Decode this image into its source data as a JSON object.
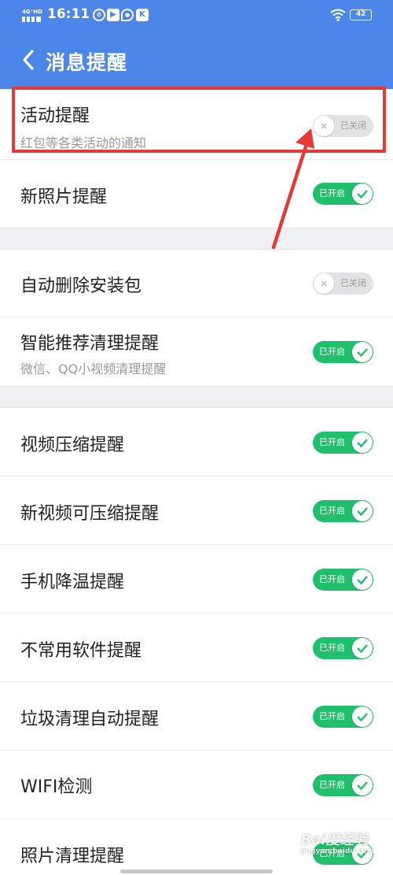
{
  "status_bar": {
    "network": "4G⁺HD",
    "time": "16:11",
    "app_icons": [
      "stopwatch-icon",
      "play-icon",
      "location-icon",
      "kuaishou-icon"
    ],
    "battery": "42"
  },
  "header": {
    "back_icon": "chevron-left-icon",
    "title": "消息提醒"
  },
  "toggle_text": {
    "on": "已开启",
    "off": "已关闭"
  },
  "groups": [
    {
      "rows": [
        {
          "label": "活动提醒",
          "sublabel": "红包等各类活动的通知",
          "enabled": false,
          "highlighted": true
        },
        {
          "label": "新照片提醒",
          "enabled": true
        }
      ]
    },
    {
      "rows": [
        {
          "label": "自动删除安装包",
          "enabled": false
        },
        {
          "label": "智能推荐清理提醒",
          "sublabel": "微信、QQ小视频清理提醒",
          "enabled": true
        }
      ]
    },
    {
      "rows": [
        {
          "label": "视频压缩提醒",
          "enabled": true
        },
        {
          "label": "新视频可压缩提醒",
          "enabled": true
        },
        {
          "label": "手机降温提醒",
          "enabled": true
        },
        {
          "label": "不常用软件提醒",
          "enabled": true
        },
        {
          "label": "垃圾清理自动提醒",
          "enabled": true
        },
        {
          "label": "WIFI检测",
          "enabled": true
        },
        {
          "label": "照片清理提醒",
          "enabled": true
        }
      ]
    }
  ],
  "annotations": {
    "highlight_color": "#e53935",
    "arrow_color": "#e53935"
  },
  "colors": {
    "header_bg": "#4c86e8",
    "toggle_on": "#1fbf6b",
    "toggle_off": "#e2e2e4"
  },
  "watermark": {
    "text": "Bai度经验",
    "sub": "jingyan.baidu.com"
  }
}
